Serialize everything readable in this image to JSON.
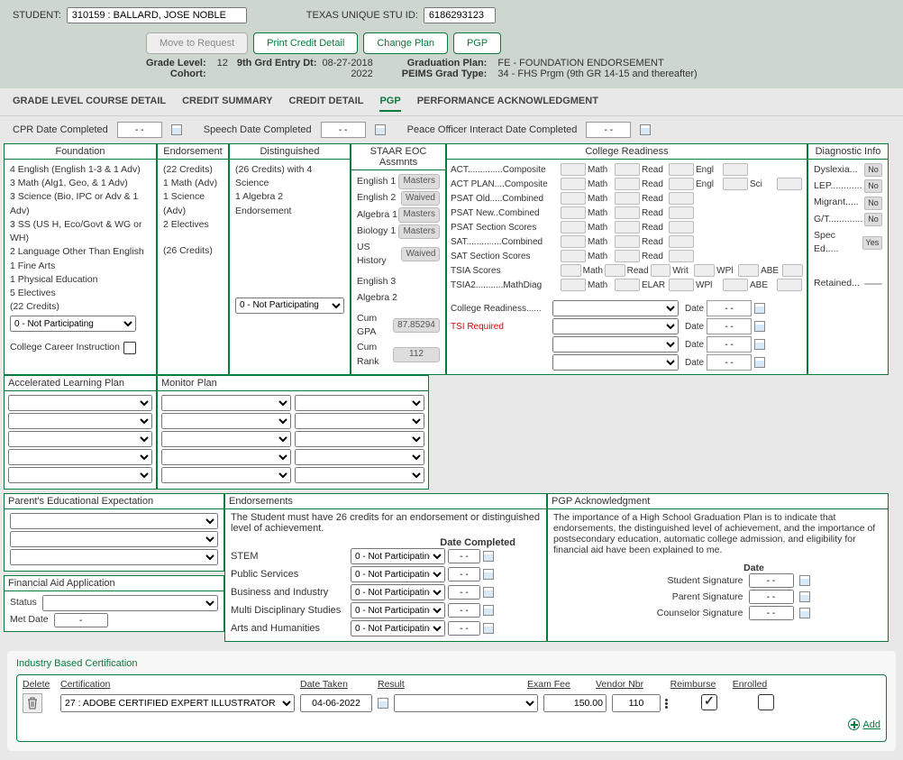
{
  "header": {
    "student_label": "STUDENT:",
    "student_value": "310159 : BALLARD, JOSE NOBLE",
    "texas_id_label": "TEXAS UNIQUE STU ID:",
    "texas_id_value": "6186293123",
    "buttons": {
      "move": "Move to Request",
      "print": "Print Credit Detail",
      "change": "Change Plan",
      "pgp": "PGP"
    },
    "info": {
      "grade_level_k": "Grade Level:",
      "grade_level_v": "12",
      "entry_k": "9th Grd Entry Dt:",
      "entry_v": "08-27-2018",
      "cohort_k": "Cohort:",
      "cohort_v": "2022",
      "grad_plan_k": "Graduation Plan:",
      "grad_plan_v": "FE - FOUNDATION ENDORSEMENT",
      "peims_k": "PEIMS Grad Type:",
      "peims_v": "34 - FHS Prgm (9th GR 14-15 and thereafter)"
    }
  },
  "tabs": [
    "GRADE LEVEL COURSE DETAIL",
    "CREDIT SUMMARY",
    "CREDIT DETAIL",
    "PGP",
    "PERFORMANCE ACKNOWLEDGMENT"
  ],
  "active_tab": "PGP",
  "dates_row": {
    "cpr_label": "CPR Date Completed",
    "speech_label": "Speech Date Completed",
    "peace_label": "Peace Officer Interact Date Completed",
    "blank": "- -"
  },
  "foundation": {
    "title": "Foundation",
    "items": [
      "4 English (English 1-3 & 1 Adv)",
      "3 Math (Alg1, Geo, & 1 Adv)",
      "3 Science (Bio, IPC or Adv & 1 Adv)",
      "3 SS (US H, Eco/Govt & WG or WH)",
      "2 Language Other Than English",
      "1 Fine Arts",
      "1 Physical Education",
      "5 Electives",
      "(22 Credits)"
    ],
    "sel": "0 - Not Participating",
    "cci_label": "College Career Instruction"
  },
  "endorsement": {
    "title": "Endorsement",
    "items": [
      "(22 Credits)",
      "1 Math (Adv)",
      "1 Science (Adv)",
      "2 Electives",
      "",
      "(26 Credits)"
    ]
  },
  "distinguished": {
    "title": "Distinguished",
    "lines": [
      "(26 Credits) with 4 Science",
      "1 Algebra 2",
      "Endorsement"
    ],
    "sel": "0 - Not Participating"
  },
  "staar": {
    "title": "STAAR EOC Assmnts",
    "rows": [
      {
        "k": "English 1",
        "v": "Masters"
      },
      {
        "k": "English 2",
        "v": "Waived"
      },
      {
        "k": "Algebra 1",
        "v": "Masters"
      },
      {
        "k": "Biology 1",
        "v": "Masters"
      },
      {
        "k": "US History",
        "v": "Waived"
      }
    ],
    "blank_rows": [
      "English 3",
      "Algebra 2"
    ],
    "gpa_k": "Cum GPA",
    "gpa_v": "87.85294",
    "rank_k": "Cum Rank",
    "rank_v": "112"
  },
  "college": {
    "title": "College Readiness",
    "rows": [
      {
        "lab": "ACT..............Composite",
        "cols": [
          "Math",
          "Read",
          "Engl"
        ]
      },
      {
        "lab": "ACT PLAN....Composite",
        "cols": [
          "Math",
          "Read",
          "Engl",
          "Sci"
        ]
      },
      {
        "lab": "PSAT Old.....Combined",
        "cols": [
          "Math",
          "Read"
        ]
      },
      {
        "lab": "PSAT New..Combined",
        "cols": [
          "Math",
          "Read"
        ]
      },
      {
        "lab": "PSAT Section Scores",
        "cols": [
          "Math",
          "Read"
        ]
      },
      {
        "lab": "SAT..............Combined",
        "cols": [
          "Math",
          "Read"
        ]
      },
      {
        "lab": "SAT Section Scores",
        "cols": [
          "Math",
          "Read"
        ]
      },
      {
        "lab": "TSIA Scores",
        "cols": [
          "Math",
          "Read",
          "Writ",
          "WPl",
          "ABE"
        ]
      },
      {
        "lab": "TSIA2...........MathDiag",
        "cols": [
          "Math",
          "ELAR",
          "WPl",
          "ABE"
        ]
      }
    ],
    "cr_label": "College Readiness......",
    "tsi_label": "TSI Required",
    "date_label": "Date",
    "blank": "- -"
  },
  "diag": {
    "title": "Diagnostic Info",
    "rows": [
      {
        "k": "Dyslexia...",
        "v": "No"
      },
      {
        "k": "LEP............",
        "v": "No"
      },
      {
        "k": "Migrant.....",
        "v": "No"
      },
      {
        "k": "G/T.............",
        "v": "No"
      },
      {
        "k": "Spec Ed.....",
        "v": "Yes"
      }
    ],
    "retained": "Retained..."
  },
  "alp": {
    "title": "Accelerated Learning Plan"
  },
  "monitor": {
    "title": "Monitor Plan"
  },
  "pee": {
    "title": "Parent's Educational Expectation"
  },
  "faa": {
    "title": "Financial Aid Application",
    "status_label": "Status",
    "met_label": "Met Date",
    "met_val": "-"
  },
  "endorsements": {
    "title": "Endorsements",
    "desc": "The Student must have 26 credits for an endorsement or distinguished level of achievement.",
    "date_hdr": "Date Completed",
    "rows": [
      {
        "k": "STEM"
      },
      {
        "k": "Public Services"
      },
      {
        "k": "Business and Industry"
      },
      {
        "k": "Multi Disciplinary Studies"
      },
      {
        "k": "Arts and Humanities"
      }
    ],
    "sel": "0 - Not Participating",
    "blank": "- -"
  },
  "ack": {
    "title": "PGP Acknowledgment",
    "desc": "The importance of a High School Graduation Plan is to indicate that endorsements, the distinguished level of achievement, and the importance of postsecondary education, automatic college admission, and eligibility for financial aid have been explained to me.",
    "date_hdr": "Date",
    "sigs": [
      "Student Signature",
      "Parent Signature",
      "Counselor Signature"
    ],
    "blank": "- -"
  },
  "ibc": {
    "title": "Industry Based Certification",
    "cols": {
      "del": "Delete",
      "cert": "Certification",
      "taken": "Date Taken",
      "result": "Result",
      "fee": "Exam Fee",
      "vendor": "Vendor Nbr",
      "reimb": "Reimburse",
      "enr": "Enrolled"
    },
    "row": {
      "cert": "27 : ADOBE CERTIFIED EXPERT ILLUSTRATOR",
      "taken": "04-06-2022",
      "result": "",
      "fee": "150.00",
      "vendor": "110",
      "reimb": true,
      "enr": false
    },
    "add_label": "Add"
  }
}
